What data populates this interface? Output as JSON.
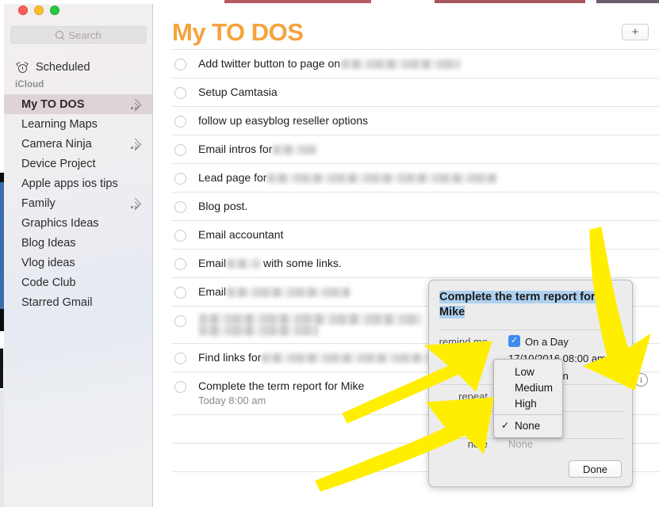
{
  "window": {
    "traffic_lights": [
      "close",
      "minimize",
      "zoom"
    ]
  },
  "sidebar": {
    "search": {
      "placeholder": "Search",
      "icon": "search-icon"
    },
    "scheduled": {
      "label": "Scheduled",
      "icon": "alarm-clock-icon"
    },
    "section_header": "iCloud",
    "items": [
      {
        "label": "My TO DOS",
        "selected": true,
        "shared": true
      },
      {
        "label": "Learning Maps",
        "selected": false,
        "shared": false
      },
      {
        "label": "Camera Ninja",
        "selected": false,
        "shared": true
      },
      {
        "label": "Device Project",
        "selected": false,
        "shared": false
      },
      {
        "label": "Apple apps ios tips",
        "selected": false,
        "shared": false
      },
      {
        "label": "Family",
        "selected": false,
        "shared": true
      },
      {
        "label": "Graphics Ideas",
        "selected": false,
        "shared": false
      },
      {
        "label": "Blog Ideas",
        "selected": false,
        "shared": false
      },
      {
        "label": "Vlog ideas",
        "selected": false,
        "shared": false
      },
      {
        "label": "Code Club",
        "selected": false,
        "shared": false
      },
      {
        "label": "Starred Gmail",
        "selected": false,
        "shared": false
      }
    ]
  },
  "main": {
    "title": "My TO DOS",
    "title_color": "#f5a33c",
    "add_button": "+",
    "todos": [
      {
        "text": "Add twitter button to page on",
        "redacted_after": 150,
        "sub": ""
      },
      {
        "text": "Setup Camtasia",
        "redacted_after": 0,
        "sub": ""
      },
      {
        "text": "follow up easyblog reseller options",
        "redacted_after": 0,
        "sub": ""
      },
      {
        "text": "Email intros for",
        "redacted_after": 56,
        "sub": ""
      },
      {
        "text": "Lead page for",
        "redacted_after": 290,
        "sub": ""
      },
      {
        "text": "Blog post.",
        "redacted_after": 0,
        "sub": ""
      },
      {
        "text": "Email accountant",
        "redacted_after": 0,
        "sub": ""
      },
      {
        "text": "Email",
        "redacted_after": 42,
        "text_after": "with some links.",
        "sub": ""
      },
      {
        "text": "Email",
        "redacted_after": 155,
        "sub": ""
      },
      {
        "text": "",
        "redacted_after": 280,
        "redacted_line2": 150,
        "sub": ""
      },
      {
        "text": "Find links for",
        "redacted_after": 260,
        "text_after": "h",
        "sub": ""
      },
      {
        "text": "Complete the term report for Mike",
        "redacted_after": 0,
        "sub": "Today 8:00 am"
      }
    ]
  },
  "popover": {
    "title": "Complete the term report for Mike",
    "title_highlighted": true,
    "rows": [
      {
        "label": "remind me",
        "value": "On a Day",
        "checkbox": true,
        "checkbox_checked": true
      },
      {
        "label": "",
        "value": "17/10/2016  08:00 am"
      },
      {
        "label": "",
        "value": "At a Location"
      },
      {
        "label": "repeat",
        "value": ""
      },
      {
        "label": "priority",
        "value": ""
      },
      {
        "label": "note",
        "value": "None",
        "muted": true
      }
    ],
    "date_value": "17/10/2016  08:00 am",
    "location_value": "At a Location",
    "location_visible_fragment": "ation",
    "repeat_label": "repeat",
    "repeat_visible_fragment": "repe",
    "priority_label": "priority",
    "priority_visible_fragment": "iori",
    "note_label": "note",
    "note_value": "None",
    "done_button": "Done",
    "checkbox_color": "#3c8cf0",
    "highlight_color": "#aed0ef"
  },
  "dropdown": {
    "name": "priority-dropdown",
    "items": [
      {
        "label": "Low",
        "checked": false
      },
      {
        "label": "Medium",
        "checked": false
      },
      {
        "label": "High",
        "checked": false
      },
      {
        "label": "None",
        "checked": true
      }
    ],
    "separator_after_index": 2,
    "check_glyph": "✓"
  },
  "info_icon": {
    "glyph": "i",
    "name": "info-icon"
  },
  "annotations": {
    "arrow_color": "#ffee00",
    "arrows": [
      {
        "name": "arrow-to-remind-me",
        "direction": "up-right"
      },
      {
        "name": "arrow-to-priority-dropdown",
        "direction": "up-right"
      },
      {
        "name": "arrow-to-info-icon",
        "direction": "down"
      }
    ]
  }
}
